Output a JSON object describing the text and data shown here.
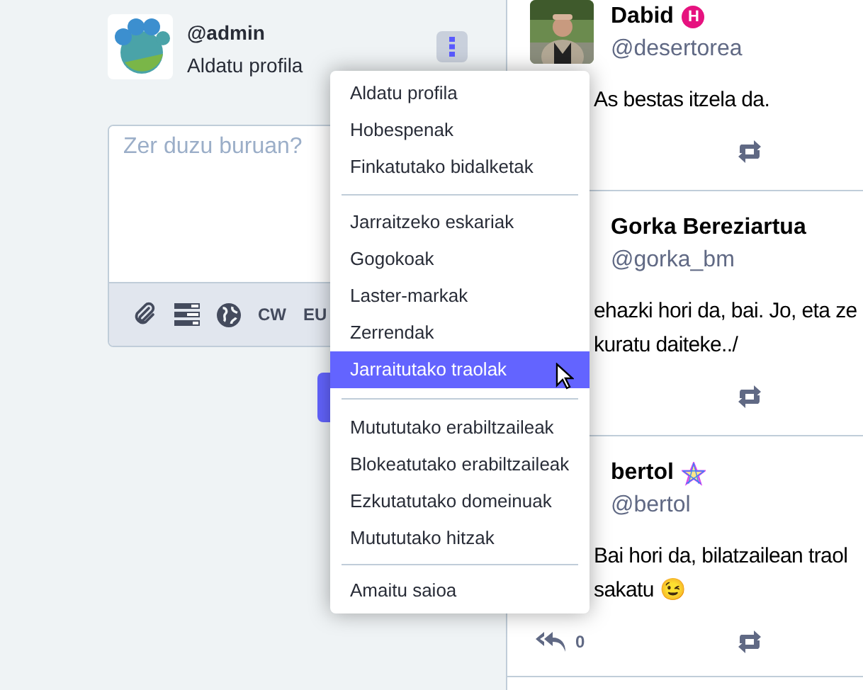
{
  "account": {
    "handle": "@admin",
    "edit_link": "Aldatu profila"
  },
  "compose": {
    "placeholder": "Zer duzu buruan?",
    "tools": [
      {
        "kind": "attach"
      },
      {
        "kind": "poll"
      },
      {
        "kind": "globe"
      },
      {
        "kind": "text",
        "label": "CW"
      },
      {
        "kind": "text",
        "label": "EU"
      }
    ]
  },
  "menu": {
    "groups": [
      [
        {
          "label": "Aldatu profila",
          "selected": false
        },
        {
          "label": "Hobespenak",
          "selected": false
        },
        {
          "label": "Finkatutako bidalketak",
          "selected": false
        }
      ],
      [
        {
          "label": "Jarraitzeko eskariak",
          "selected": false
        },
        {
          "label": "Gogokoak",
          "selected": false
        },
        {
          "label": "Laster-markak",
          "selected": false
        },
        {
          "label": "Zerrendak",
          "selected": false
        },
        {
          "label": "Jarraitutako traolak",
          "selected": true
        }
      ],
      [
        {
          "label": "Mutututako erabiltzaileak",
          "selected": false
        },
        {
          "label": "Blokeatutako erabiltzaileak",
          "selected": false
        },
        {
          "label": "Ezkutatutako domeinuak",
          "selected": false
        },
        {
          "label": "Mutututako hitzak",
          "selected": false
        }
      ],
      [
        {
          "label": "Amaitu saioa",
          "selected": false
        }
      ]
    ]
  },
  "posts": [
    {
      "name": "Dabid",
      "badge": {
        "kind": "letter",
        "text": "H"
      },
      "handle": "@desertorea",
      "avatar": {
        "kind": "picture"
      },
      "lines": [
        "As bestas itzela da."
      ]
    },
    {
      "name": "Gorka Bereziartua",
      "handle": "@gorka_bm",
      "lines": [
        "ehazki hori da, bai. Jo, eta ze",
        "kuratu daiteke../"
      ]
    },
    {
      "name": "bertol",
      "badge": {
        "kind": "star"
      },
      "handle": "@bertol",
      "lines": [
        "Bai hori da, bilatzailean traol",
        "sakatu 😉"
      ],
      "reply_count": "0"
    }
  ]
}
